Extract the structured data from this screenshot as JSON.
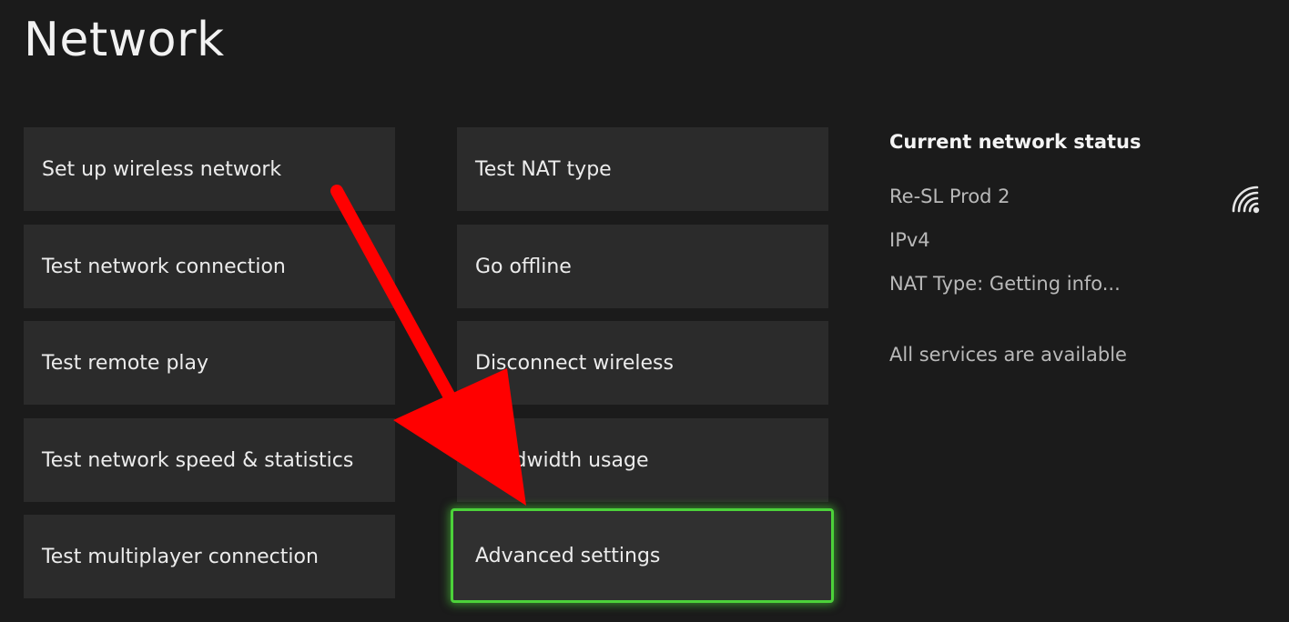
{
  "page": {
    "title": "Network"
  },
  "menu": {
    "left_column": [
      {
        "label": "Set up wireless network"
      },
      {
        "label": "Test network connection"
      },
      {
        "label": "Test remote play"
      },
      {
        "label": "Test network speed & statistics"
      },
      {
        "label": "Test multiplayer connection"
      }
    ],
    "right_column": [
      {
        "label": "Test NAT type"
      },
      {
        "label": "Go offline"
      },
      {
        "label": "Disconnect wireless"
      },
      {
        "label": "Bandwidth usage"
      },
      {
        "label": "Advanced settings",
        "focused": true
      }
    ]
  },
  "status": {
    "heading": "Current network status",
    "network_name": "Re-SL Prod 2",
    "ip_version": "IPv4",
    "nat_type": "NAT Type: Getting info...",
    "services": "All services are available",
    "wifi_icon": "wifi-signal-icon"
  },
  "colors": {
    "background": "#1b1b1b",
    "tile": "#2b2b2b",
    "focus_border": "#4cd23a",
    "annotation_arrow": "#ff0000"
  }
}
